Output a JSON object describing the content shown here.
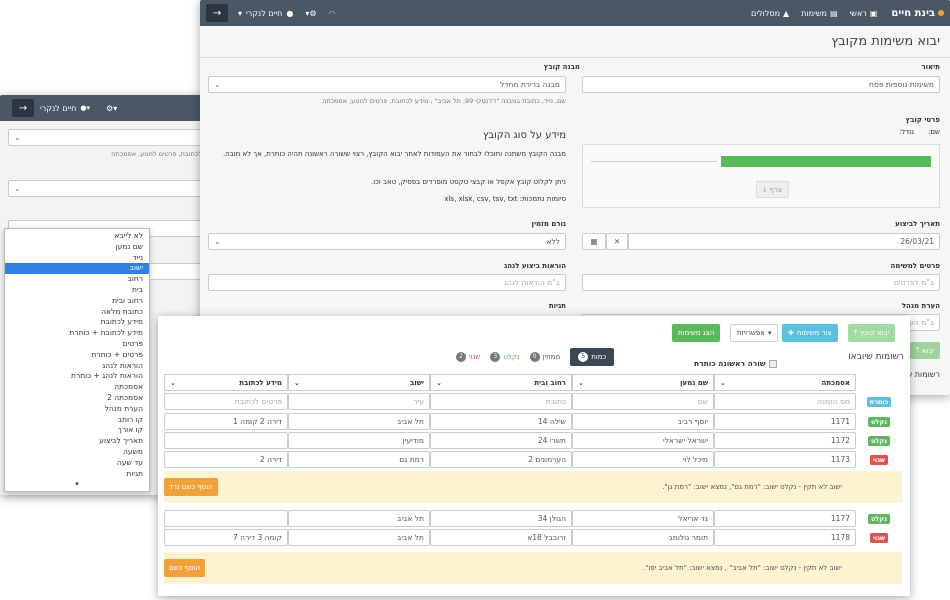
{
  "back_window": {
    "nav": {
      "user": "חיים לנקרי"
    },
    "dropdown_hint": "ע לכתובת, פרטים למנוע, אסמכתה",
    "options": [
      "לא לייבא",
      "שם נמען",
      "נייד",
      "ישוב",
      "רחוב",
      "בית",
      "רחוב ובית",
      "כתובת מלאה",
      "מידע לכתובת",
      "מידע לכתובת + כותרת",
      "פרטים",
      "פרטים + כותרת",
      "הוראות לנהג",
      "הוראות לנהג + כותרת",
      "אסמכתה",
      "אסמכתה 2",
      "הערת מנהל",
      "קו רוחב",
      "קו אורך",
      "תאריך לביצוע",
      "משעה",
      "עד שעה",
      "תגיות"
    ],
    "selected_index": 3,
    "checked_index": 10
  },
  "main_window": {
    "nav": {
      "brand": "בינת חיים",
      "items": [
        "ראשי",
        "משימות",
        "מסלולים"
      ],
      "user": "חיים לנקרי"
    },
    "title": "יבוא משימות מקובץ",
    "description": {
      "label": "תיאור",
      "value": "משימות נוספות פסח"
    },
    "file_structure": {
      "label": "מבנה קובץ",
      "value": "מבנה ברירת מחדל",
      "hint": "שם, נייד, כתובת במבנה \"ז'ז'נסקי 99, תל אביב\" , מידע לכתובת, פרטים למנוע, אסמכתה"
    },
    "file_details": {
      "label": "פרטי קובץ",
      "name_label": "שם:",
      "size_label": "גודל:",
      "attach": "צרף"
    },
    "file_info": {
      "title": "מידע על סוג הקובץ",
      "p1": "מבנה הקובץ משתנה ותוכלו לבחור את העמודות לאחר יבוא הקובץ, רצוי ששורה ראשונה תהיה כותרת, אך לא חובה.",
      "p2": "ניתן לקלוט קובץ אקסל או קבצי טקסט מופרדים בפסיק, טאב וכו.",
      "p3": "סיומות נתמכות: xls, xlsx, csv, tsv, txt"
    },
    "exec_date": {
      "label": "תאריך לביצוע",
      "value": "26/03/21"
    },
    "orderer": {
      "label": "גורם מזמין",
      "value": "ללא"
    },
    "task_details": {
      "label": "פרטים למשימה",
      "placeholder": "ב\"מ לפרטים"
    },
    "driver_instructions": {
      "label": "הוראות ביצוע לנהג",
      "placeholder": "ב\"מ הוראות לנהג"
    },
    "manager_note": {
      "label": "הערת מנהל",
      "placeholder": "ב\"מ הער"
    },
    "tags": {
      "label": "תגיות"
    },
    "import_btn": "יבוא",
    "tasks_list_label": "רשומות ש"
  },
  "front_window": {
    "title": "רשומות שיובאו",
    "buttons": {
      "import": "יבוא קובץ",
      "add_task": "צור משימות",
      "options": "אפשרויות",
      "show_task": "הצג משימות"
    },
    "first_row_header": "שורה ראשונה כותרת",
    "tabs": [
      {
        "label": "כמות",
        "n": "5"
      },
      {
        "label": "ממתין",
        "n": "0"
      },
      {
        "label": "נקלט",
        "n": "3"
      },
      {
        "label": "שגוי",
        "n": "2"
      }
    ],
    "columns": [
      "אסמכתה",
      "שם נמען",
      "רחוב ובית",
      "ישוב",
      "מידע לכתובת"
    ],
    "header_row": {
      "badge": "כותרת",
      "cells": [
        "מס הזמנה",
        "שם",
        "כתובת",
        "עיר",
        "פרטים לכתובת"
      ]
    },
    "rows": [
      {
        "badge": "נקלט",
        "cells": [
          "1171",
          "יוסף רביב",
          "שילה 14",
          "תל אביב",
          "דירה 2 קומה 1"
        ]
      },
      {
        "badge": "נקלט",
        "cells": [
          "1172",
          "ישראל ישראלי",
          "תשרי 24",
          "מודיעין",
          ""
        ]
      },
      {
        "badge": "שגוי",
        "cells": [
          "1173",
          "מיכל לוי",
          "הערמונים 2",
          "רמת גם",
          "דירה 2"
        ]
      }
    ],
    "warning1": {
      "text": "ישוב לא תקין - נקלט ישוב: \"רמת גם\", נמצא ישוב: \"רמת גן\".",
      "btn": "הוסף כשם נרד"
    },
    "rows2": [
      {
        "badge": "נקלט",
        "cells": [
          "1177",
          "גד אריאל",
          "הגולן 34",
          "תל אביב",
          ""
        ]
      },
      {
        "badge": "שגוי",
        "cells": [
          "1178",
          "תומר גולומב",
          "זרובבל 18א",
          "תל אביב",
          "קומה 3 דירה 7"
        ]
      }
    ],
    "warning2": {
      "text": "ישוב לא תקין - נקלט ישוב: \"תל אביב\" , נמצא ישוב: \"תל אביב יפו\".",
      "btn": "הוסף כשם"
    }
  },
  "colors": {
    "nav": "#4a5866",
    "green": "#5cb85c",
    "red": "#d9534f",
    "blue": "#5bc0de",
    "orange": "#f0a23a",
    "select_blue": "#2f80e0"
  }
}
